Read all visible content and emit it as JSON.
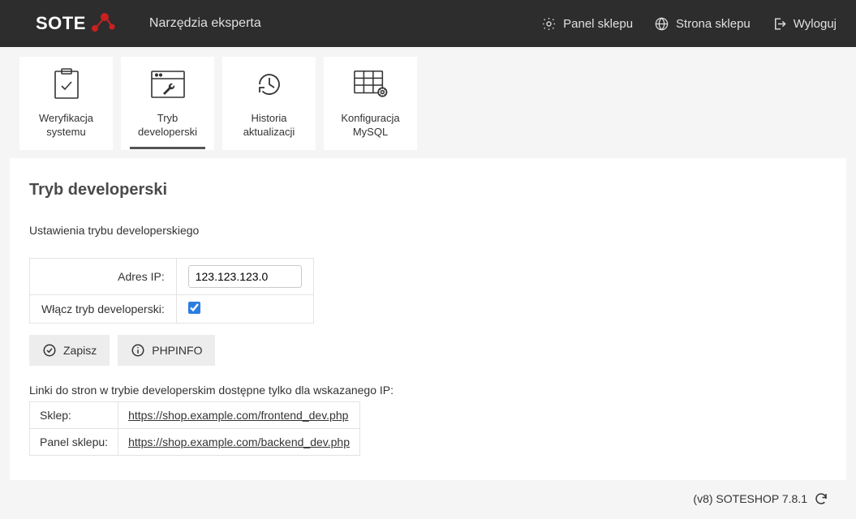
{
  "header": {
    "logo_text": "SOTE",
    "title": "Narzędzia eksperta",
    "nav": {
      "panel": "Panel sklepu",
      "store": "Strona sklepu",
      "logout": "Wyloguj"
    }
  },
  "tabs": [
    {
      "label": "Weryfikacja systemu",
      "icon": "clipboard-check-icon",
      "active": false
    },
    {
      "label": "Tryb developerski",
      "icon": "window-wrench-icon",
      "active": true
    },
    {
      "label": "Historia aktualizacji",
      "icon": "history-icon",
      "active": false
    },
    {
      "label": "Konfiguracja MySQL",
      "icon": "table-gear-icon",
      "active": false
    }
  ],
  "panel": {
    "heading": "Tryb developerski",
    "subtitle": "Ustawienia trybu developerskiego",
    "form": {
      "ip_label": "Adres IP:",
      "ip_value": "123.123.123.0",
      "enable_label": "Włącz tryb developerski:",
      "enable_checked": true
    },
    "buttons": {
      "save": "Zapisz",
      "phpinfo": "PHPINFO"
    },
    "links": {
      "caption": "Linki do stron w trybie developerskim dostępne tylko dla wskazanego IP:",
      "rows": [
        {
          "label": "Sklep:",
          "url": "https://shop.example.com/frontend_dev.php"
        },
        {
          "label": "Panel sklepu:",
          "url": "https://shop.example.com/backend_dev.php"
        }
      ]
    }
  },
  "footer": {
    "text": "(v8) SOTESHOP 7.8.1"
  }
}
